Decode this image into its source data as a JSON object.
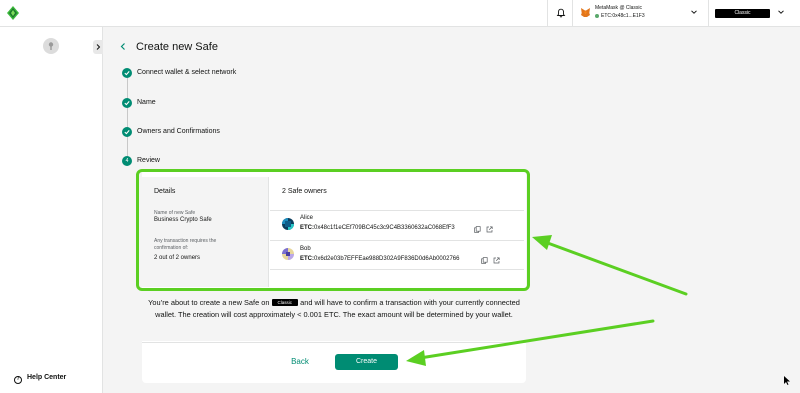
{
  "topbar": {
    "wallet_name": "MetaMask @ Classic",
    "wallet_address": "ETC:0x48c1...E1F3",
    "network": "Classic"
  },
  "sidebar": {
    "help_center": "Help Center"
  },
  "page": {
    "title": "Create new Safe"
  },
  "steps": [
    {
      "label": "Connect wallet & select network",
      "status": "done"
    },
    {
      "label": "Name",
      "status": "done"
    },
    {
      "label": "Owners and Confirmations",
      "status": "done"
    },
    {
      "label": "Review",
      "status": "current",
      "number": "4"
    }
  ],
  "review": {
    "details_title": "Details",
    "name_label": "Name of new Safe",
    "name_value": "Business Crypto Safe",
    "threshold_label_1": "Any transaction requires the",
    "threshold_label_2": "confirmation of:",
    "threshold_value": "2 out of 2 owners",
    "owners_title": "2 Safe owners",
    "owners": [
      {
        "name": "Alice",
        "prefix": "ETC:",
        "address": "0x48c1f1eCEf709BC45c3c9C4B3360632aC068EfF3"
      },
      {
        "name": "Bob",
        "prefix": "ETC:",
        "address": "0x6d2e03b7EFFEae988D302A9F836D0d6Ab0002766"
      }
    ]
  },
  "info": {
    "part1": "You’re about to create a new Safe on",
    "chip": "Classic",
    "part2": "and will have to confirm a transaction with your currently connected wallet. The creation will cost approximately < 0.001 ETC. The exact amount will be determined by your wallet."
  },
  "actions": {
    "back": "Back",
    "create": "Create"
  },
  "colors": {
    "accent": "#008c73",
    "annotation": "#5bcf22"
  }
}
